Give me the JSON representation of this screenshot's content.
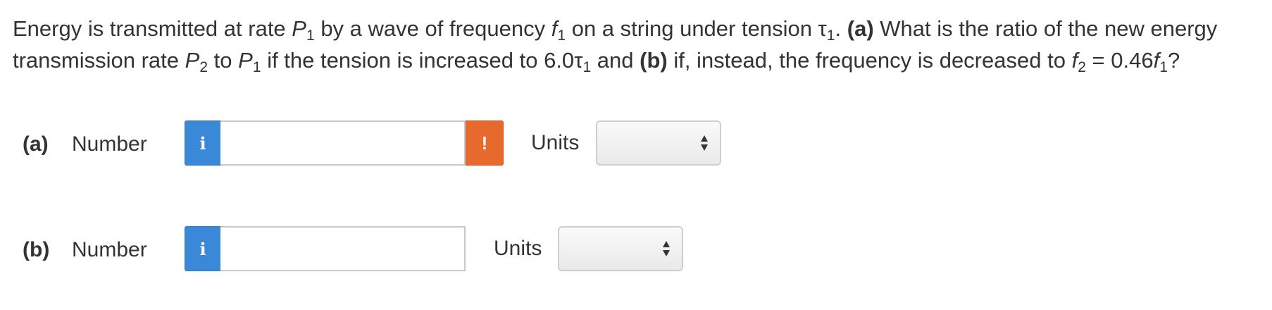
{
  "question": {
    "text_1": "Energy is transmitted at rate ",
    "P": "P",
    "sub_1": "1",
    "text_2": " by a wave of frequency ",
    "f": "f",
    "text_3": " on a string under tension ",
    "tau": "τ",
    "text_4": ". ",
    "part_a_tag": "(a)",
    "text_5": " What is the ratio of the new energy",
    "text_6": "transmission rate ",
    "sub_2": "2",
    "text_7": " to ",
    "text_8": " if the tension is increased to 6.0",
    "text_9": " and ",
    "part_b_tag": "(b)",
    "text_10": " if, instead, the frequency is decreased to ",
    "text_11": " = 0.46",
    "text_12": "?"
  },
  "answers": [
    {
      "part_label": "(a)",
      "number_label": "Number",
      "info_icon": "i",
      "value": "",
      "warning_icon": "!",
      "units_label": "Units",
      "units_selected": ""
    },
    {
      "part_label": "(b)",
      "number_label": "Number",
      "info_icon": "i",
      "value": "",
      "units_label": "Units",
      "units_selected": ""
    }
  ],
  "colors": {
    "info_button": "#3a88d8",
    "warning_button": "#e8692e"
  },
  "icons": {
    "info": "info-icon",
    "warning": "warning-icon",
    "select": "updown-arrows-icon"
  }
}
